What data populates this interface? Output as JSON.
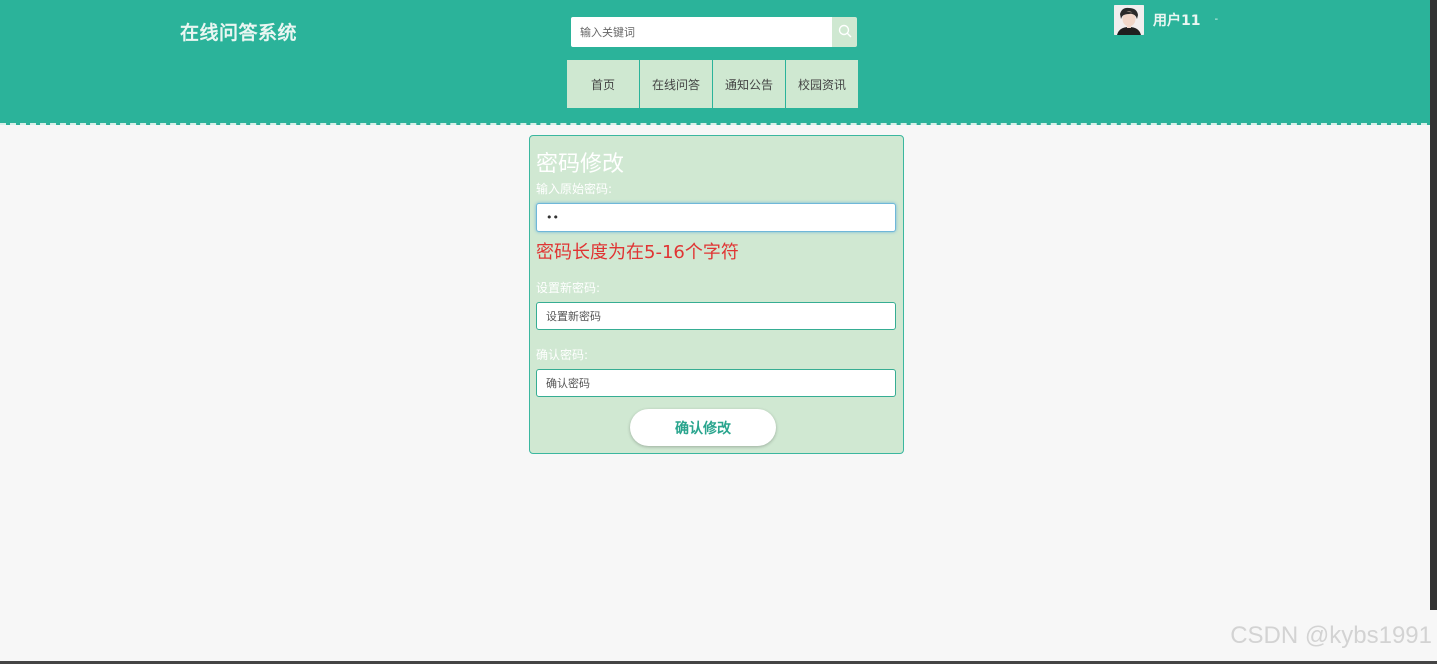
{
  "header": {
    "site_title": "在线问答系统",
    "search": {
      "placeholder": "输入关键词"
    },
    "nav": [
      {
        "label": "首页"
      },
      {
        "label": "在线问答"
      },
      {
        "label": "通知公告"
      },
      {
        "label": "校园资讯"
      }
    ],
    "user": {
      "name": "用户11",
      "caret": "-"
    }
  },
  "form": {
    "title": "密码修改",
    "old_password": {
      "label": "输入原始密码:",
      "value": "••"
    },
    "error": "密码长度为在5-16个字符",
    "new_password": {
      "label": "设置新密码:",
      "placeholder": "设置新密码"
    },
    "confirm_password": {
      "label": "确认密码:",
      "placeholder": "确认密码"
    },
    "submit_label": "确认修改"
  },
  "watermark": "CSDN @kybs1991",
  "colors": {
    "header_bg": "#2bb39a",
    "nav_bg": "#cfe8d1",
    "panel_bg": "#d0e8d2",
    "error": "#e03433",
    "accent": "#2aa58e"
  },
  "icons": {
    "search": "search-icon",
    "avatar": "user-avatar"
  }
}
